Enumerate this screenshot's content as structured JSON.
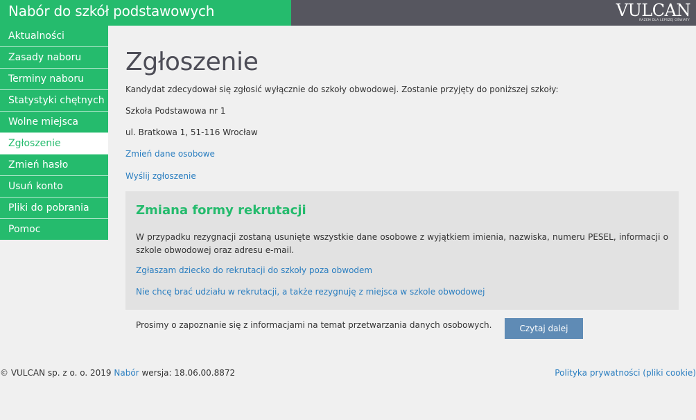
{
  "header": {
    "app_title": "Nabór do szkół podstawowych",
    "logo_text": "VULCAN",
    "logo_tagline": "RAZEM DLA LEPSZEJ OŚWIATY"
  },
  "sidebar": {
    "items": [
      {
        "label": "Aktualności"
      },
      {
        "label": "Zasady naboru"
      },
      {
        "label": "Terminy naboru"
      },
      {
        "label": "Statystyki chętnych"
      },
      {
        "label": "Wolne miejsca"
      },
      {
        "label": "Zgłoszenie"
      },
      {
        "label": "Zmień hasło"
      },
      {
        "label": "Usuń konto"
      },
      {
        "label": "Pliki do pobrania"
      },
      {
        "label": "Pomoc"
      }
    ],
    "active_label": "Zgłoszenie"
  },
  "main": {
    "title": "Zgłoszenie",
    "info_text": "Kandydat zdecydował się zgłosić wyłącznie do szkoły obwodowej. Zostanie przyjęty do poniższej szkoły:",
    "school_name": "Szkoła Podstawowa nr 1",
    "school_address": "ul. Bratkowa 1, 51-116 Wrocław",
    "change_data_link": "Zmień dane osobowe",
    "send_link": "Wyślij zgłoszenie"
  },
  "panel": {
    "title": "Zmiana formy rekrutacji",
    "description": "W przypadku rezygnacji zostaną usunięte wszystkie dane osobowe z wyjątkiem imienia, nazwiska, numeru PESEL, informacji o szkole obwodowej oraz adresu e-mail.",
    "link_outside": "Zgłaszam dziecko do rekrutacji do szkoły poza obwodem",
    "link_resign": "Nie chcę brać udziału w rekrutacji, a także rezygnuję z miejsca w szkole obwodowej"
  },
  "privacy": {
    "text": "Prosimy o zapoznanie się z informacjami na temat przetwarzania danych osobowych.",
    "button_label": "Czytaj dalej"
  },
  "footer": {
    "copyright": "© VULCAN sp. z o. o. 2019",
    "app_link": "Nabór",
    "version": "wersja: 18.06.00.8872",
    "privacy_link": "Polityka prywatności (pliki cookie)"
  },
  "colors": {
    "brand_green": "#25bb6d",
    "header_dark": "#56565f",
    "link_blue": "#2a7ec0",
    "button_blue": "#5f8bb5",
    "panel_gray": "#e2e2e2"
  }
}
